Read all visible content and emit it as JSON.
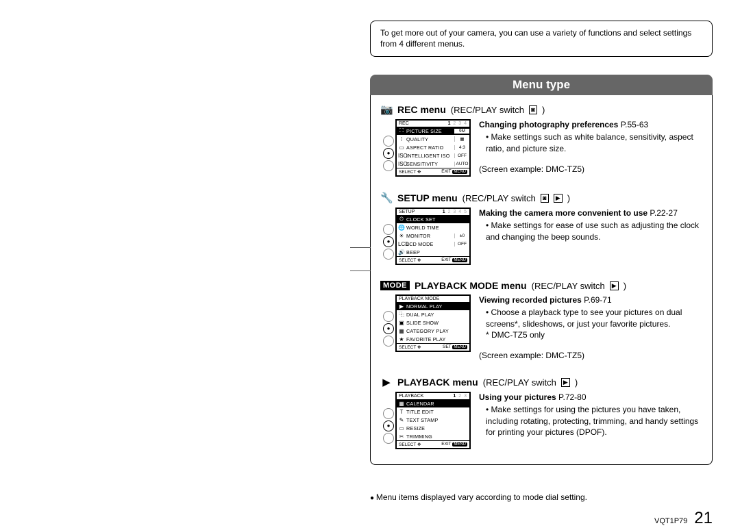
{
  "intro": "To get more out of your camera, you can use a variety of functions and select settings from 4 different menus.",
  "header": "Menu type",
  "sections": [
    {
      "icon": "📷",
      "title": "REC menu",
      "sub": "(REC/PLAY switch",
      "switch_icons": [
        "📷"
      ],
      "sub_close": ")",
      "screen": {
        "top_label": "REC",
        "pages_active": "1",
        "pages_rest": "2 3 4",
        "rows": [
          {
            "icon": "⛶",
            "label": "PICTURE SIZE",
            "val": "9M",
            "hl": true
          },
          {
            "icon": "⁞",
            "label": "QUALITY",
            "val": "▦"
          },
          {
            "icon": "▭",
            "label": "ASPECT RATIO",
            "val": "4:3"
          },
          {
            "icon": "ISO",
            "label": "INTELLIGENT ISO",
            "val": "OFF"
          },
          {
            "icon": "ISO",
            "label": "SENSITIVITY",
            "val": "AUTO"
          }
        ],
        "bot_left": "SELECT ✥",
        "bot_right": "EXIT",
        "bot_btn": "MENU"
      },
      "desc_title": "Changing photography preferences",
      "desc_ref": "P.55-63",
      "desc_items": [
        "Make settings such as white balance, sensitivity, aspect ratio, and picture size."
      ],
      "note_after": "(Screen example: DMC-TZ5)"
    },
    {
      "icon": "🔧",
      "title": "SETUP menu",
      "sub": "(REC/PLAY switch",
      "switch_icons": [
        "📷",
        "▶"
      ],
      "sub_close": ")",
      "screen": {
        "top_label": "SETUP",
        "pages_active": "1",
        "pages_rest": "2 3 4 5",
        "rows": [
          {
            "icon": "⏲",
            "label": "CLOCK SET",
            "val": "",
            "hl": true
          },
          {
            "icon": "🌐",
            "label": "WORLD TIME",
            "val": ""
          },
          {
            "icon": "☀",
            "label": "MONITOR",
            "val": "±0"
          },
          {
            "icon": "LCD",
            "label": "LCD MODE",
            "val": "OFF"
          },
          {
            "icon": "🔊",
            "label": "BEEP",
            "val": ""
          }
        ],
        "bot_left": "SELECT ✥",
        "bot_right": "EXIT",
        "bot_btn": "MENU"
      },
      "desc_title": "Making the camera more convenient to use",
      "desc_ref": "P.22-27",
      "desc_items": [
        "Make settings for ease of use such as adjusting the clock and changing the beep sounds."
      ]
    },
    {
      "icon_mode": "MODE",
      "title": "PLAYBACK MODE menu",
      "sub": "(REC/PLAY switch",
      "switch_icons": [
        "▶"
      ],
      "sub_close": ")",
      "screen": {
        "top_label": "PLAYBACK MODE",
        "rows": [
          {
            "icon": "▶",
            "label": "NORMAL PLAY",
            "val": "",
            "hl": true
          },
          {
            "icon": "⿻",
            "label": "DUAL PLAY",
            "val": ""
          },
          {
            "icon": "▣",
            "label": "SLIDE SHOW",
            "val": ""
          },
          {
            "icon": "▦",
            "label": "CATEGORY PLAY",
            "val": ""
          },
          {
            "icon": "★",
            "label": "FAVORITE PLAY",
            "val": ""
          }
        ],
        "bot_left": "SELECT ✥",
        "bot_right": "SET",
        "bot_btn": "MENU"
      },
      "desc_title": "Viewing recorded pictures",
      "desc_ref": "P.69-71",
      "desc_items": [
        "Choose a playback type to see your pictures on dual screens*, slideshows, or just your favorite pictures."
      ],
      "desc_foot": "* DMC-TZ5 only",
      "note_after": "(Screen example: DMC-TZ5)"
    },
    {
      "icon": "▶",
      "title": "PLAYBACK menu",
      "sub": "(REC/PLAY switch",
      "switch_icons": [
        "▶"
      ],
      "sub_close": ")",
      "screen": {
        "top_label": "PLAYBACK",
        "pages_active": "1",
        "pages_rest": "2 3",
        "rows": [
          {
            "icon": "▦",
            "label": "CALENDAR",
            "val": "",
            "hl": true
          },
          {
            "icon": "T",
            "label": "TITLE EDIT",
            "val": ""
          },
          {
            "icon": "✎",
            "label": "TEXT STAMP",
            "val": ""
          },
          {
            "icon": "▭",
            "label": "RESIZE",
            "val": ""
          },
          {
            "icon": "✂",
            "label": "TRIMMING",
            "val": ""
          }
        ],
        "bot_left": "SELECT ✥",
        "bot_right": "EXIT",
        "bot_btn": "MENU"
      },
      "desc_title": "Using your pictures",
      "desc_ref": "P.72-80",
      "desc_items": [
        "Make settings for using the pictures you have taken, including rotating, protecting, trimming, and handy settings for printing your pictures (DPOF)."
      ]
    }
  ],
  "bottom_note": "Menu items displayed vary according to mode dial setting.",
  "doc_id": "VQT1P79",
  "page_num": "21"
}
